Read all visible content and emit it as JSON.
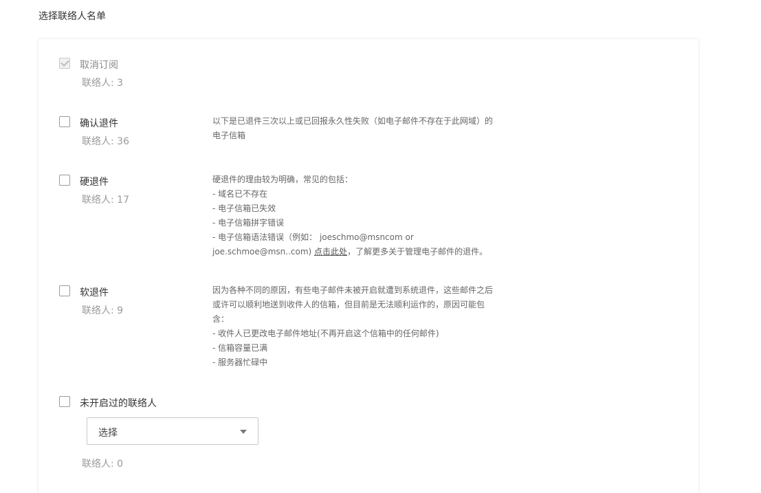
{
  "page": {
    "title": "选择联络人名单"
  },
  "options": [
    {
      "label": "取消订阅",
      "count": "联络人: 3",
      "checked": true,
      "disabled": true
    },
    {
      "label": "确认退件",
      "count": "联络人: 36",
      "checked": false,
      "description": [
        "以下是已退件三次以上或已回报永久性失败（如电子邮件不存在于此网域）的",
        "电子信箱"
      ]
    },
    {
      "label": "硬退件",
      "count": "联络人: 17",
      "checked": false,
      "description": [
        "硬退件的理由较为明确，常见的包括：",
        "- 域名已不存在",
        "- 电子信箱已失效",
        "- 电子信箱拼字错误",
        "- 电子信箱语法错误（例如： joeschmo@msncom or"
      ],
      "description_last_prefix": "joe.schmoe@msn..com) ",
      "description_link": "点击此处",
      "description_last_suffix": "，了解更多关于管理电子邮件的退件。"
    },
    {
      "label": "软退件",
      "count": "联络人: 9",
      "checked": false,
      "description": [
        "因为各种不同的原因，有些电子邮件未被开启就遭到系统退件，这些邮件之后",
        "或许可以顺利地送到收件人的信箱，但目前是无法顺利运作的，原因可能包",
        "含：",
        "- 收件人已更改电子邮件地址(不再开启这个信箱中的任何邮件)",
        "- 信箱容量已满",
        "- 服务器忙碌中"
      ]
    },
    {
      "label": "未开启过的联络人",
      "count": "联络人: 0",
      "checked": false,
      "select_value": "选择"
    }
  ],
  "colors": {
    "border": "#c8c8c8",
    "text": "#333333",
    "muted": "#9a9a9a"
  }
}
